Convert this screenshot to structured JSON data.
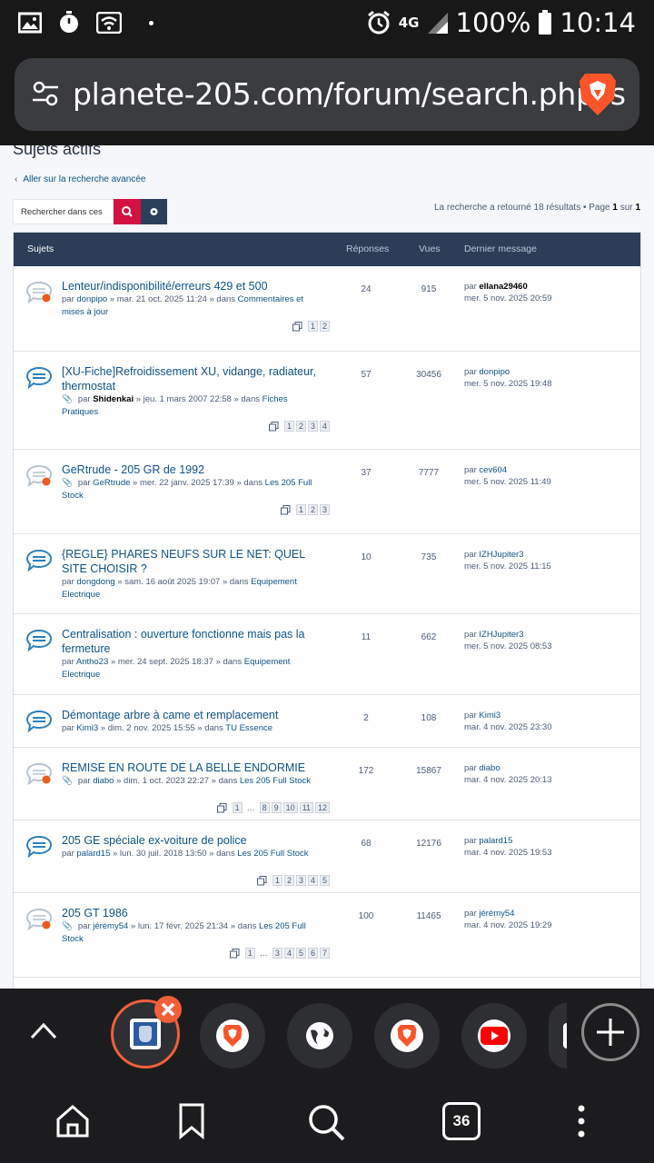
{
  "status": {
    "signal": "4G",
    "battery": "100%",
    "time": "10:14"
  },
  "browser": {
    "url": "planete-205.com/forum/search.php?s",
    "tab_count": "36"
  },
  "page": {
    "heading": "Sujets actifs",
    "advanced_link": "Aller sur la recherche avancée",
    "search_placeholder": "Rechercher dans ces",
    "results_prefix": "La recherche a retourné 18 résultats • Page",
    "results_page": "1",
    "results_of": "sur",
    "results_total": "1"
  },
  "table": {
    "headers": {
      "subjects": "Sujets",
      "replies": "Réponses",
      "views": "Vues",
      "last": "Dernier message"
    },
    "rows": [
      {
        "title": "Lenteur/indisponibilité/erreurs 429 et 500",
        "unread": true,
        "attach": false,
        "by": "par",
        "author": "donpipo",
        "date": "» mar. 21 oct. 2025 11:24 » dans",
        "forum": "Commentaires et mises à jour",
        "pages": [
          "1",
          "2"
        ],
        "replies": "24",
        "views": "915",
        "last_by": "par",
        "last_user": "ellana29460",
        "last_user_bold": true,
        "last_date": "mer. 5 nov. 2025 20:59"
      },
      {
        "title": "[XU-Fiche]Refroidissement XU, vidange, radiateur, thermostat",
        "unread": false,
        "attach": true,
        "by": "par",
        "author": "Shidenkai",
        "author_bold": true,
        "date": "» jeu. 1 mars 2007 22:58 » dans",
        "forum": "Fiches Pratiques",
        "pages": [
          "1",
          "2",
          "3",
          "4"
        ],
        "replies": "57",
        "views": "30456",
        "last_by": "par",
        "last_user": "donpipo",
        "last_date": "mer. 5 nov. 2025 19:48"
      },
      {
        "title": "GeRtrude - 205 GR de 1992",
        "unread": true,
        "attach": true,
        "by": "par",
        "author": "GeRtrude",
        "date": "» mer. 22 janv. 2025 17:39 » dans",
        "forum": "Les 205 Full Stock",
        "pages": [
          "1",
          "2",
          "3"
        ],
        "replies": "37",
        "views": "7777",
        "last_by": "par",
        "last_user": "cev604",
        "last_date": "mer. 5 nov. 2025 11:49"
      },
      {
        "title": "{REGLE} PHARES NEUFS SUR LE NET: QUEL SITE CHOISIR ?",
        "unread": false,
        "attach": false,
        "by": "par",
        "author": "dongdong",
        "date": "» sam. 16 août 2025 19:07 » dans",
        "forum": "Equipement Electrique",
        "pages": [],
        "replies": "10",
        "views": "735",
        "last_by": "par",
        "last_user": "IZHJupiter3",
        "last_date": "mer. 5 nov. 2025 11:15"
      },
      {
        "title": "Centralisation : ouverture fonctionne mais pas la fermeture",
        "unread": false,
        "attach": false,
        "by": "par",
        "author": "Antho23",
        "date": "» mer. 24 sept. 2025 18:37 » dans",
        "forum": "Equipement Electrique",
        "pages": [],
        "replies": "11",
        "views": "662",
        "last_by": "par",
        "last_user": "IZHJupiter3",
        "last_date": "mer. 5 nov. 2025 08:53"
      },
      {
        "title": "Démontage arbre à came et remplacement",
        "unread": false,
        "attach": false,
        "by": "par",
        "author": "Kimi3",
        "date": "» dim. 2 nov. 2025 15:55 » dans",
        "forum": "TU Essence",
        "pages": [],
        "replies": "2",
        "views": "108",
        "last_by": "par",
        "last_user": "Kimi3",
        "last_date": "mar. 4 nov. 2025 23:30"
      },
      {
        "title": "REMISE EN ROUTE DE LA BELLE ENDORMIE",
        "unread": true,
        "attach": true,
        "by": "par",
        "author": "diabo",
        "date": "» dim. 1 oct. 2023 22:27 » dans",
        "forum": "Les 205 Full Stock",
        "pages": [
          "1",
          "…",
          "8",
          "9",
          "10",
          "11",
          "12"
        ],
        "replies": "172",
        "views": "15867",
        "last_by": "par",
        "last_user": "diabo",
        "last_date": "mar. 4 nov. 2025 20:13"
      },
      {
        "title": "205 GE spéciale ex-voiture de police",
        "unread": false,
        "attach": false,
        "by": "par",
        "author": "palard15",
        "date": "» lun. 30 juil. 2018 13:50 » dans",
        "forum": "Les 205 Full Stock",
        "pages": [
          "1",
          "2",
          "3",
          "4",
          "5"
        ],
        "replies": "68",
        "views": "12176",
        "last_by": "par",
        "last_user": "palard15",
        "last_date": "mar. 4 nov. 2025 19:53"
      },
      {
        "title": "205 GT 1986",
        "unread": true,
        "attach": true,
        "by": "par",
        "author": "jérémy54",
        "date": "» lun. 17 févr. 2025 21:34 » dans",
        "forum": "Les 205 Full Stock",
        "pages": [
          "1",
          "…",
          "3",
          "4",
          "5",
          "6",
          "7"
        ],
        "replies": "100",
        "views": "11465",
        "last_by": "par",
        "last_user": "jérémy54",
        "last_date": "mar. 4 nov. 2025 19:29"
      }
    ]
  },
  "colors": {
    "accent": "#105289",
    "unread_dot": "#ec5a1f",
    "header_bg": "#2b3d57",
    "search_btn": "#d31141"
  },
  "tabs": [
    "forum-favicon",
    "brave-icon",
    "globe-icon",
    "brave-icon",
    "youtube-icon",
    "partial-tab"
  ]
}
